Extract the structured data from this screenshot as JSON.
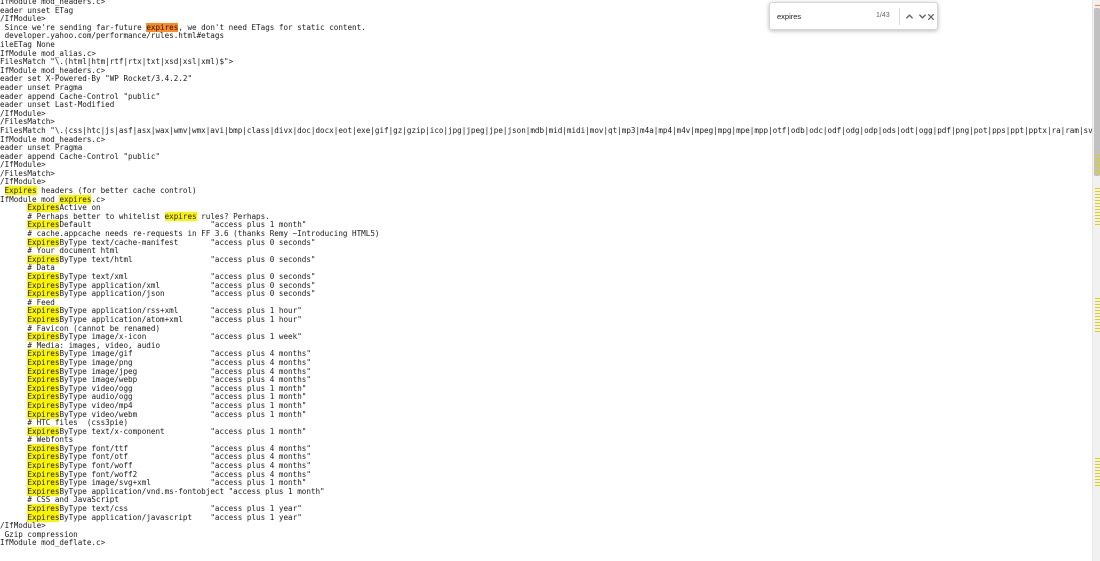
{
  "find_bar": {
    "query": "expires",
    "match_count": "1/43"
  },
  "colors": {
    "match_highlight": "#fbf500",
    "current_match": "#ff8a1f",
    "text": "#1a1a1a"
  },
  "icons": {
    "previous": "chevron-up-icon",
    "next": "chevron-down-icon",
    "close": "close-icon"
  },
  "editor": {
    "lines": [
      "IfModule mod_headers.c>",
      "eader unset ETag",
      "/IfModule>",
      " Since we're sending far-future expires, we don't need ETags for static content.",
      " developer.yahoo.com/performance/rules.html#etags",
      "ileETag None",
      "IfModule mod_alias.c>",
      "FilesMatch \"\\.(html|htm|rtf|rtx|txt|xsd|xsl|xml)$\">",
      "IfModule mod_headers.c>",
      "eader set X-Powered-By \"WP Rocket/3.4.2.2\"",
      "eader unset Pragma",
      "eader append Cache-Control \"public\"",
      "eader unset Last-Modified",
      "/IfModule>",
      "/FilesMatch>",
      "FilesMatch \"\\.(css|htc|js|asf|asx|wax|wmv|wmx|avi|bmp|class|divx|doc|docx|eot|exe|gif|gz|gzip|ico|jpg|jpeg|jpe|json|mdb|mid|midi|mov|qt|mp3|m4a|mp4|m4v|mpeg|mpg|mpe|mpp|otf|odb|odc|odf|odg|odp|ods|odt|ogg|pdf|png|pot|pps|ppt|pptx|ra|ram|svg|svgz|swf|tar|tif|tiff|tt",
      "IfModule mod_headers.c>",
      "eader unset Pragma",
      "eader append Cache-Control \"public\"",
      "/IfModule>",
      "/FilesMatch>",
      "/IfModule>",
      " Expires headers (for better cache control)",
      "IfModule mod_expires.c>",
      "      ExpiresActive on",
      "      # Perhaps better to whitelist expires rules? Perhaps.",
      "      ExpiresDefault                          \"access plus 1 month\"",
      "      # cache.appcache needs re-requests in FF 3.6 (thanks Remy ~Introducing HTML5)",
      "      ExpiresByType text/cache-manifest       \"access plus 0 seconds\"",
      "      # Your document html",
      "      ExpiresByType text/html                 \"access plus 0 seconds\"",
      "      # Data",
      "      ExpiresByType text/xml                  \"access plus 0 seconds\"",
      "      ExpiresByType application/xml           \"access plus 0 seconds\"",
      "      ExpiresByType application/json          \"access plus 0 seconds\"",
      "      # Feed",
      "      ExpiresByType application/rss+xml       \"access plus 1 hour\"",
      "      ExpiresByType application/atom+xml      \"access plus 1 hour\"",
      "      # Favicon (cannot be renamed)",
      "      ExpiresByType image/x-icon              \"access plus 1 week\"",
      "      # Media: images, video, audio",
      "      ExpiresByType image/gif                 \"access plus 4 months\"",
      "      ExpiresByType image/png                 \"access plus 4 months\"",
      "      ExpiresByType image/jpeg                \"access plus 4 months\"",
      "      ExpiresByType image/webp                \"access plus 4 months\"",
      "      ExpiresByType video/ogg                 \"access plus 1 month\"",
      "      ExpiresByType audio/ogg                 \"access plus 1 month\"",
      "      ExpiresByType video/mp4                 \"access plus 1 month\"",
      "      ExpiresByType video/webm                \"access plus 1 month\"",
      "      # HTC files  (css3pie)",
      "      ExpiresByType text/x-component          \"access plus 1 month\"",
      "      # Webfonts",
      "      ExpiresByType font/ttf                  \"access plus 4 months\"",
      "      ExpiresByType font/otf                  \"access plus 4 months\"",
      "      ExpiresByType font/woff                 \"access plus 4 months\"",
      "      ExpiresByType font/woff2                \"access plus 4 months\"",
      "      ExpiresByType image/svg+xml             \"access plus 1 month\"",
      "      ExpiresByType application/vnd.ms-fontobject \"access plus 1 month\"",
      "      # CSS and JavaScript",
      "      ExpiresByType text/css                  \"access plus 1 year\"",
      "      ExpiresByType application/javascript    \"access plus 1 year\"",
      "/IfModule>",
      " Gzip compression",
      "IfModule mod_deflate.c>"
    ]
  }
}
